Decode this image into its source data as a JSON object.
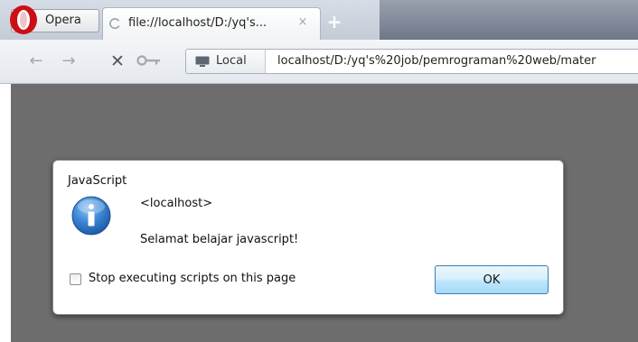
{
  "browser": {
    "menu_button_label": "Opera",
    "tab": {
      "title": "file://localhost/D:/yq's...",
      "close_glyph": "×"
    },
    "new_tab_glyph": "+",
    "nav": {
      "back_glyph": "←",
      "forward_glyph": "→",
      "stop_glyph": "✕"
    },
    "address": {
      "badge_label": "Local",
      "url": "localhost/D:/yq's%20job/pemrograman%20web/mater"
    }
  },
  "dialog": {
    "title": "JavaScript",
    "origin": "<localhost>",
    "message": "Selamat belajar javascript!",
    "checkbox_label": "Stop executing scripts on this page",
    "checkbox_checked": false,
    "ok_label": "OK"
  },
  "colors": {
    "page_background": "#6d6d6d",
    "info_icon_blue": "#2f73c4",
    "opera_red": "#cc0f16",
    "ok_button_border": "#3c7fb1"
  },
  "icons": {
    "menu": "opera-logo-icon",
    "tab_loading": "loading-icon",
    "tab_close": "close-icon",
    "new_tab": "plus-icon",
    "back": "back-arrow-icon",
    "forward": "forward-arrow-icon",
    "stop": "stop-icon",
    "wand": "key-icon",
    "site": "monitor-icon",
    "dialog": "info-icon"
  }
}
